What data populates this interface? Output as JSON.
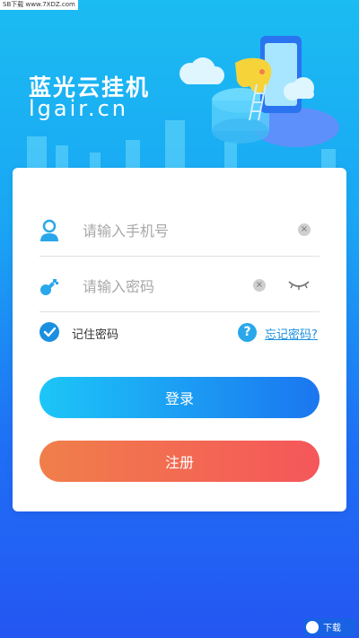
{
  "watermark_top": "SB下载 www.7XDZ.com",
  "brand": {
    "title": "蓝光云挂机",
    "subtitle": "lgair.cn"
  },
  "form": {
    "phone_placeholder": "请输入手机号",
    "password_placeholder": "请输入密码",
    "remember_label": "记住密码",
    "remember_checked": true,
    "forgot_label": "忘记密码?",
    "help_glyph": "?",
    "clear_glyph": "×"
  },
  "buttons": {
    "login_label": "登录",
    "register_label": "注册"
  },
  "colors": {
    "accent_blue": "#1a8fe0",
    "login_gradient_start": "#1cc6f7",
    "login_gradient_end": "#1b76f0",
    "register_gradient_start": "#f07f4a",
    "register_gradient_end": "#f5565a"
  },
  "icons": {
    "phone_field": "user-icon",
    "password_field": "key-icon",
    "clear": "clear-icon",
    "visibility": "eye-closed-icon",
    "remember": "check-icon",
    "help": "help-icon"
  },
  "watermark_bottom": "下载"
}
